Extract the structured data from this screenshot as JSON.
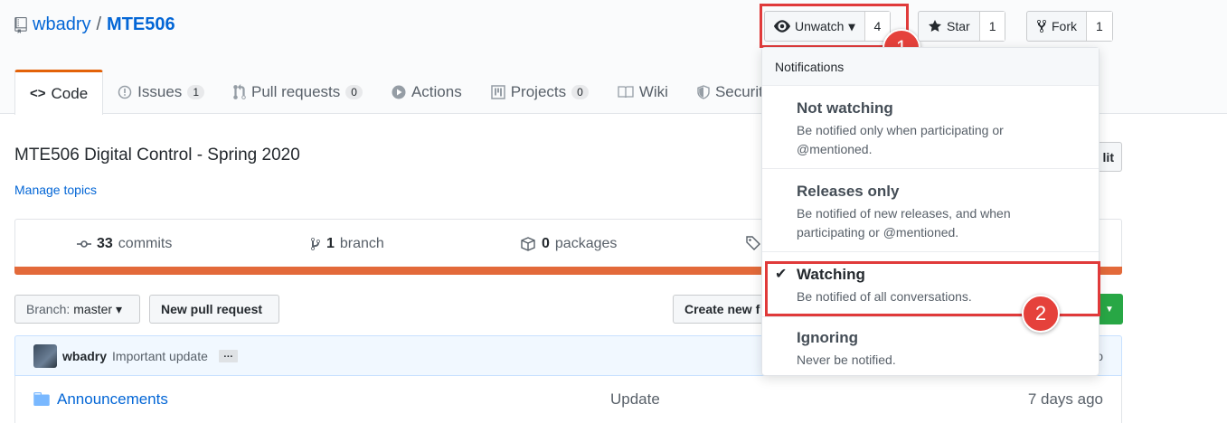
{
  "repo": {
    "owner": "wbadry",
    "separator": "/",
    "name": "MTE506"
  },
  "actions": {
    "watch": {
      "label": "Unwatch",
      "count": "4"
    },
    "star": {
      "label": "Star",
      "count": "1"
    },
    "fork": {
      "label": "Fork",
      "count": "1"
    }
  },
  "tabs": [
    {
      "label": "Code"
    },
    {
      "label": "Issues",
      "count": "1"
    },
    {
      "label": "Pull requests",
      "count": "0"
    },
    {
      "label": "Actions"
    },
    {
      "label": "Projects",
      "count": "0"
    },
    {
      "label": "Wiki"
    },
    {
      "label": "Security"
    }
  ],
  "description": "MTE506 Digital Control - Spring 2020",
  "manage_topics": "Manage topics",
  "edit_label": "lit",
  "summary": {
    "commits_count": "33",
    "commits_label": "commits",
    "branch_count": "1",
    "branch_label": "branch",
    "packages_count": "0",
    "packages_label": "packages"
  },
  "toolbar": {
    "branch_prefix": "Branch:",
    "branch_name": "master",
    "new_pr": "New pull request",
    "create_new": "Create new f"
  },
  "commit": {
    "author": "wbadry",
    "message": "Important update",
    "ellipsis": "…",
    "age_fragment": "o"
  },
  "files": [
    {
      "name": "Announcements",
      "message": "Update",
      "age": "7 days ago"
    }
  ],
  "notifications": {
    "header": "Notifications",
    "options": [
      {
        "title": "Not watching",
        "desc": "Be notified only when participating or @mentioned."
      },
      {
        "title": "Releases only",
        "desc": "Be notified of new releases, and when participating or @mentioned."
      },
      {
        "title": "Watching",
        "desc": "Be notified of all conversations.",
        "selected": true
      },
      {
        "title": "Ignoring",
        "desc": "Never be notified."
      }
    ]
  },
  "annotations": {
    "step1": "1",
    "step2": "2"
  },
  "colors": {
    "link": "#0366d6",
    "accent": "#e36209",
    "annotation": "#e03a3a",
    "green": "#28a745"
  }
}
